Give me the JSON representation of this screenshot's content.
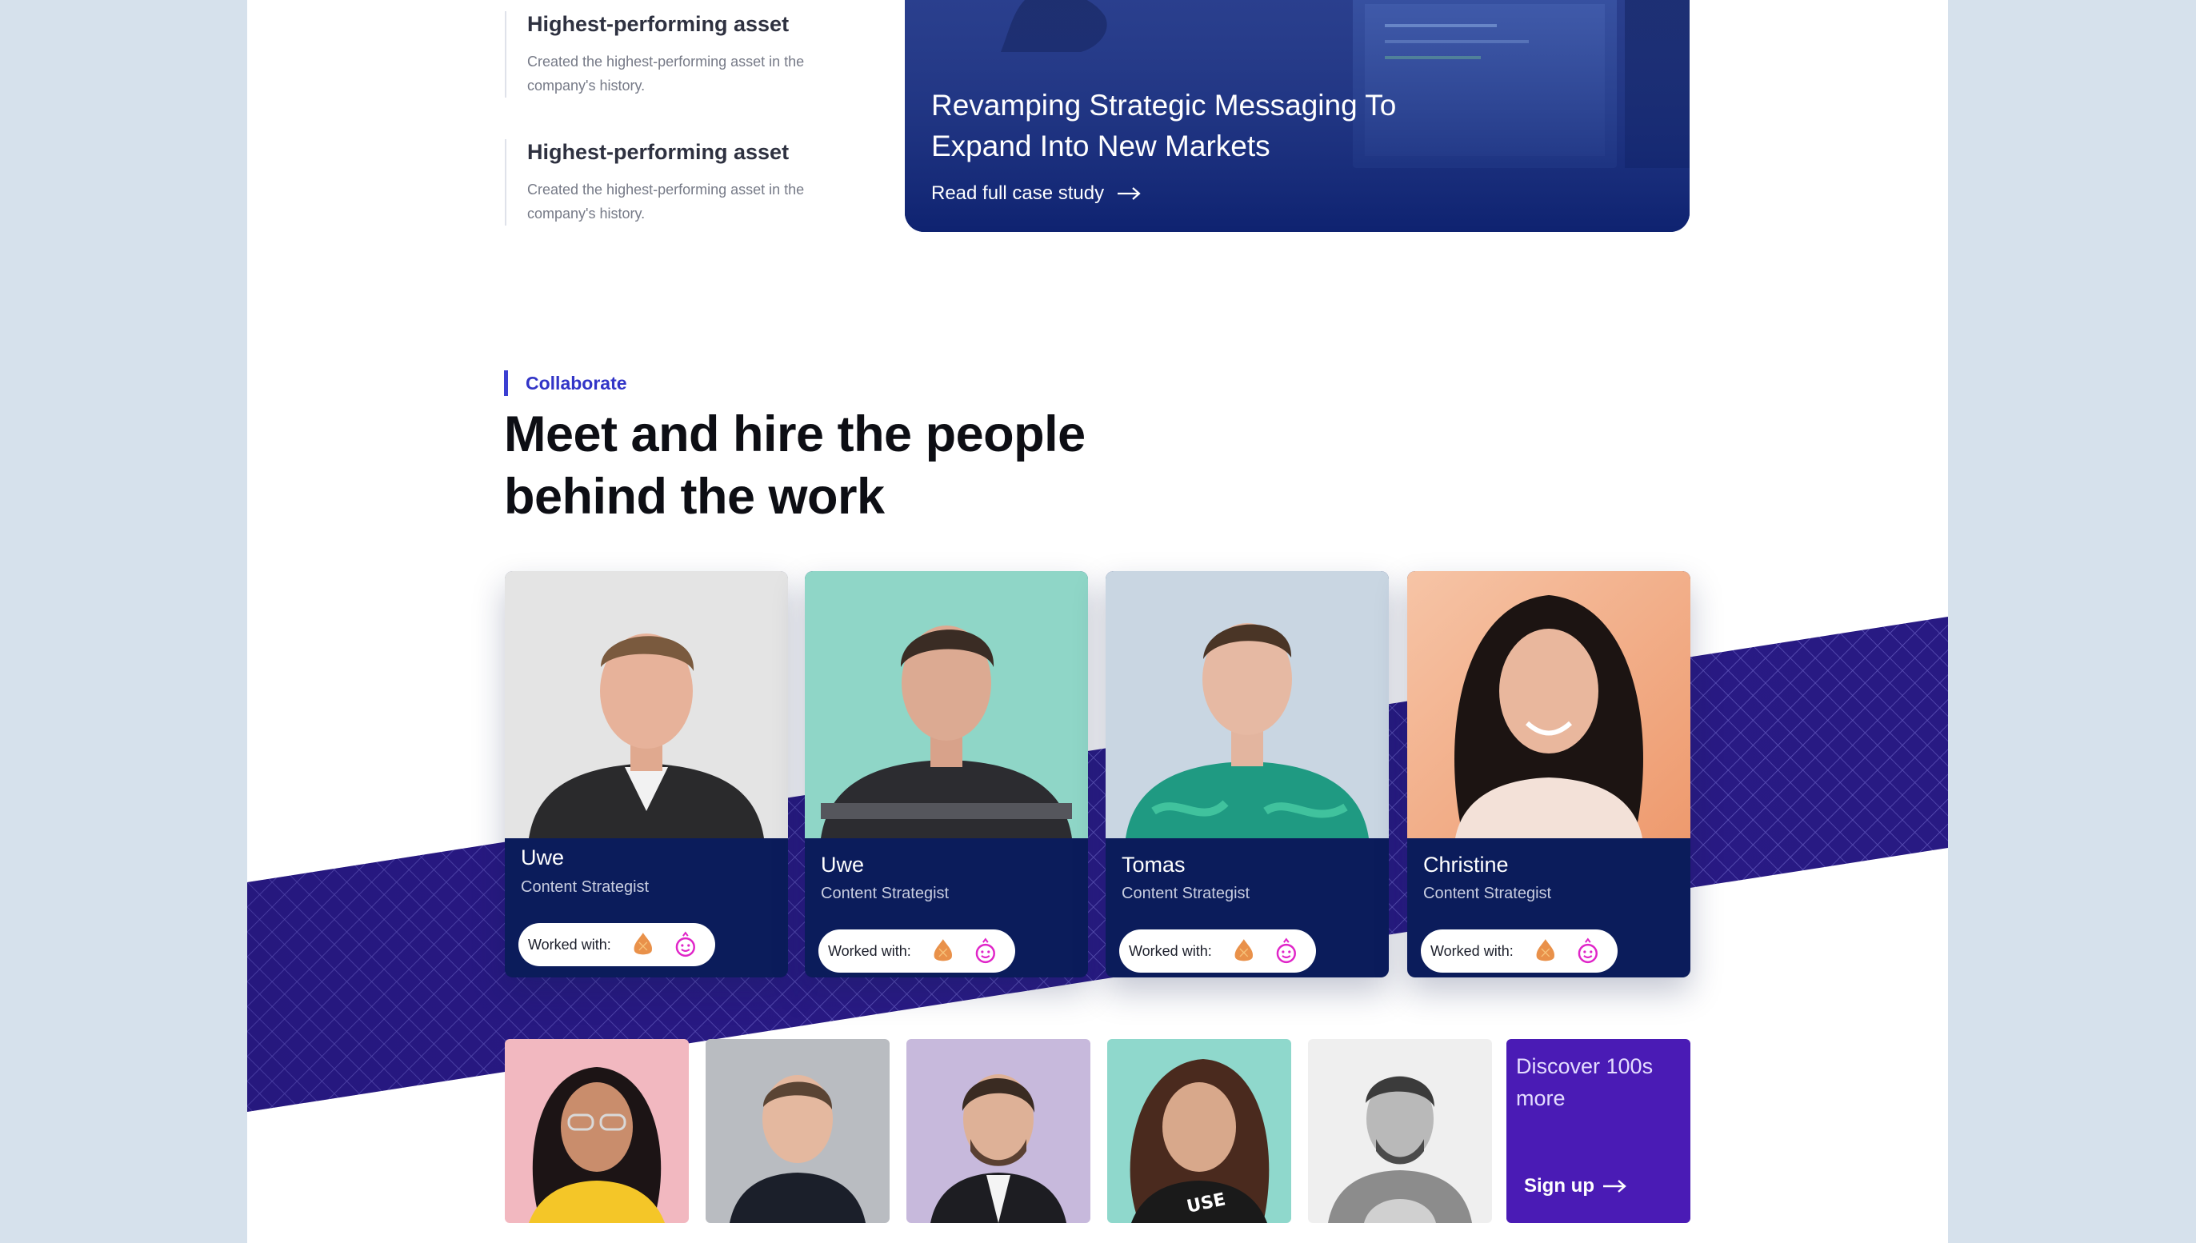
{
  "features": [
    {
      "title": "Highest-performing asset",
      "desc": "Created the highest-performing asset in the company's history."
    },
    {
      "title": "Highest-performing asset",
      "desc": "Created the highest-performing asset in the company's history."
    }
  ],
  "case_study": {
    "title": "Revamping Strategic Messaging To Expand Into New Markets",
    "link": "Read full case study"
  },
  "collaborate": {
    "eyebrow": "Collaborate",
    "headline": "Meet and hire the people behind the work"
  },
  "people": [
    {
      "name": "Uwe",
      "role": "Content Strategist",
      "worked_with": "Worked with:"
    },
    {
      "name": "Uwe",
      "role": "Content Strategist",
      "worked_with": "Worked with:"
    },
    {
      "name": "Tomas",
      "role": "Content Strategist",
      "worked_with": "Worked with:"
    },
    {
      "name": "Christine",
      "role": "Content Strategist",
      "worked_with": "Worked with:"
    }
  ],
  "discover": {
    "title": "Discover 100s more",
    "cta": "Sign up"
  },
  "colors": {
    "accent": "#3b3fd2",
    "card_navy": "#0b1c5b",
    "band_purple": "#2a1b86",
    "discover_purple": "#4a1bb5",
    "page_bg": "#d6e1ec"
  },
  "icons": {
    "arrow": "arrow-right-icon",
    "client_logo_1": "orange-drop-logo",
    "client_logo_2": "magenta-face-logo"
  }
}
